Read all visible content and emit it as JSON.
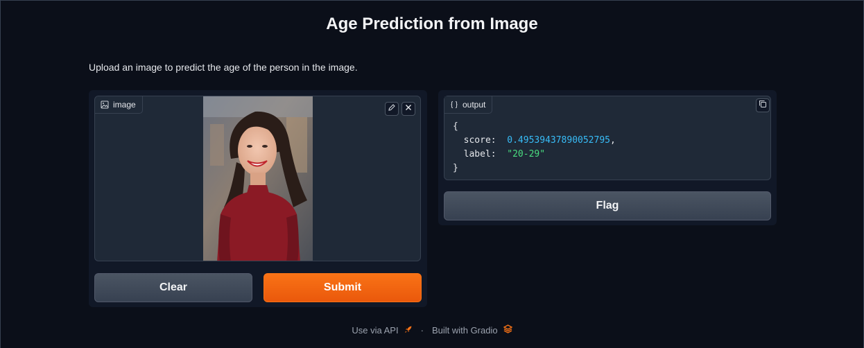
{
  "header": {
    "title": "Age Prediction from Image",
    "description": "Upload an image to predict the age of the person in the image."
  },
  "input": {
    "label": "image",
    "icons": [
      "image-icon",
      "edit-icon",
      "close-icon"
    ]
  },
  "buttons": {
    "clear_label": "Clear",
    "submit_label": "Submit",
    "flag_label": "Flag"
  },
  "output": {
    "label": "output",
    "json": {
      "open_brace": "{",
      "score_key": "score:",
      "score_value": "0.49539437890052795",
      "label_key": "label:",
      "label_value": "\"20-29\"",
      "close_brace": "}"
    }
  },
  "footer": {
    "api_text": "Use via API",
    "separator": "·",
    "built_text": "Built with Gradio"
  },
  "colors": {
    "background": "#0b0f19",
    "panel": "#1f2937",
    "accent": "#f97316",
    "number": "#38bdf8",
    "string": "#4ade80"
  }
}
